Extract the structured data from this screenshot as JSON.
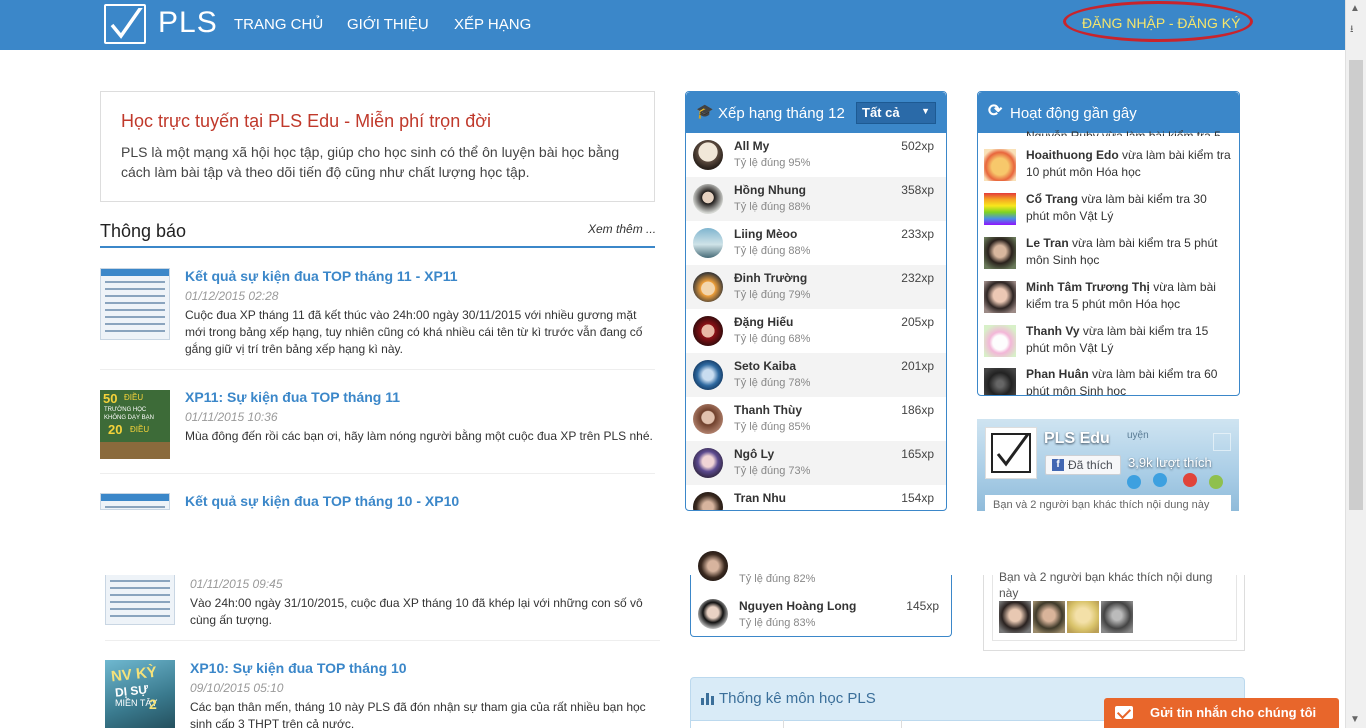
{
  "nav": {
    "logo_text": "PLS",
    "links": [
      "TRANG CHỦ",
      "GIỚI THIỆU",
      "XẾP HẠNG"
    ],
    "login_label": "ĐĂNG NHẬP - ĐĂNG KÝ"
  },
  "intro": {
    "title": "Học trực tuyến tại PLS Edu - Miễn phí trọn đời",
    "text": "PLS là một mạng xã hội học tập, giúp cho học sinh có thể ôn luyện bài học bằng cách làm bài tập và theo dõi tiến độ cũng như chất lượng học tập."
  },
  "notices": {
    "title": "Thông báo",
    "more": "Xem thêm ...",
    "items": [
      {
        "title": "Kết quả sự kiện đua TOP tháng 11 - XP11",
        "date": "01/12/2015 02:28",
        "body": "Cuộc đua XP tháng 11 đã kết thúc vào 24h:00 ngày 30/11/2015 với nhiều gương mặt mới trong bảng xếp hạng, tuy nhiên cũng có khá nhiều cái tên từ kì trước vẫn đang cố gắng giữ vị trí trên bảng xếp hạng kì này."
      },
      {
        "title": "XP11: Sự kiện đua TOP tháng 11",
        "date": "01/11/2015 10:36",
        "body": "Mùa đông đến rồi các bạn ơi, hãy làm nóng người bằng một cuộc đua XP trên PLS nhé."
      },
      {
        "title": "Kết quả sự kiện đua TOP tháng 10 - XP10",
        "date": "01/11/2015 09:45",
        "body": "Vào 24h:00 ngày 31/10/2015, cuộc đua XP tháng 10 đã khép lại với những con số vô cùng ấn tượng."
      },
      {
        "title": "XP10: Sự kiện đua TOP tháng 10",
        "date": "09/10/2015 05:10",
        "body": "Các bạn thân mến, tháng 10 này PLS đã đón nhận sự tham gia của rất nhiều bạn học sinh cấp 3 THPT trên cả nước."
      }
    ],
    "thumb_text_book": [
      "50",
      "ĐIỀU",
      "TRƯỜNG HỌC",
      "KHÔNG DẠY BẠN",
      "20",
      "ĐIỀU"
    ],
    "thumb_text_nvky": [
      "NV KỲ",
      "DỊ SỰ",
      "MIỀN TÂY",
      "2"
    ]
  },
  "ranking": {
    "title": "Xếp hạng tháng 12",
    "filter": "Tất cả",
    "rows": [
      {
        "name": "All My",
        "rate": "Tỷ lệ đúng 95%",
        "xp": "502xp"
      },
      {
        "name": "Hồng Nhung",
        "rate": "Tỷ lệ đúng 88%",
        "xp": "358xp"
      },
      {
        "name": "Liing Mèoo",
        "rate": "Tỷ lệ đúng 88%",
        "xp": "233xp"
      },
      {
        "name": "Đinh Trường",
        "rate": "Tỷ lệ đúng 79%",
        "xp": "232xp"
      },
      {
        "name": "Đặng Hiếu",
        "rate": "Tỷ lệ đúng 68%",
        "xp": "205xp"
      },
      {
        "name": "Seto Kaiba",
        "rate": "Tỷ lệ đúng 78%",
        "xp": "201xp"
      },
      {
        "name": "Thanh Thùy",
        "rate": "Tỷ lệ đúng 85%",
        "xp": "186xp"
      },
      {
        "name": "Ngô Ly",
        "rate": "Tỷ lệ đúng 73%",
        "xp": "165xp"
      },
      {
        "name": "Tran Nhu",
        "rate": "",
        "xp": "154xp"
      }
    ],
    "lower_rows": [
      {
        "name": "",
        "rate": "Tỷ lệ đúng 82%",
        "xp": ""
      },
      {
        "name": "Nguyen Hoàng Long",
        "rate": "Tỷ lệ đúng 83%",
        "xp": "145xp"
      }
    ]
  },
  "activity": {
    "title": "Hoạt động gần gây",
    "partial_top": "Nguyễn Ruby vừa làm bài kiểm tra 5",
    "rows": [
      {
        "name": "Hoaithuong Edo",
        "text": " vừa làm bài kiểm tra 10 phút môn Hóa học"
      },
      {
        "name": "Cổ Trang",
        "text": " vừa làm bài kiểm tra 30 phút môn Vật Lý"
      },
      {
        "name": "Le Tran",
        "text": " vừa làm bài kiểm tra 5 phút môn Sinh học"
      },
      {
        "name": "Minh Tâm Trương Thị",
        "text": " vừa làm bài kiểm tra 5 phút môn Hóa học"
      },
      {
        "name": "Thanh Vy",
        "text": " vừa làm bài kiểm tra 15 phút môn Vật Lý"
      },
      {
        "name": "Phan Huân",
        "text": " vừa làm bài kiểm tra 60 phút môn Sinh học"
      }
    ]
  },
  "facebook": {
    "page_name": "PLS Edu",
    "like_button": "Đã thích",
    "like_count": "3,9k lượt thích",
    "friends_text": "Bạn và 2 người bạn khác thích nội dung này",
    "cover_text": "uyện"
  },
  "stats": {
    "title": "Thống kê môn học PLS"
  },
  "message_button": "Gửi tin nhắn cho chúng tôi",
  "colors": {
    "nav": "#3b87c9",
    "accent": "#c0392b",
    "login": "#f7e66b",
    "message": "#e8662b"
  }
}
